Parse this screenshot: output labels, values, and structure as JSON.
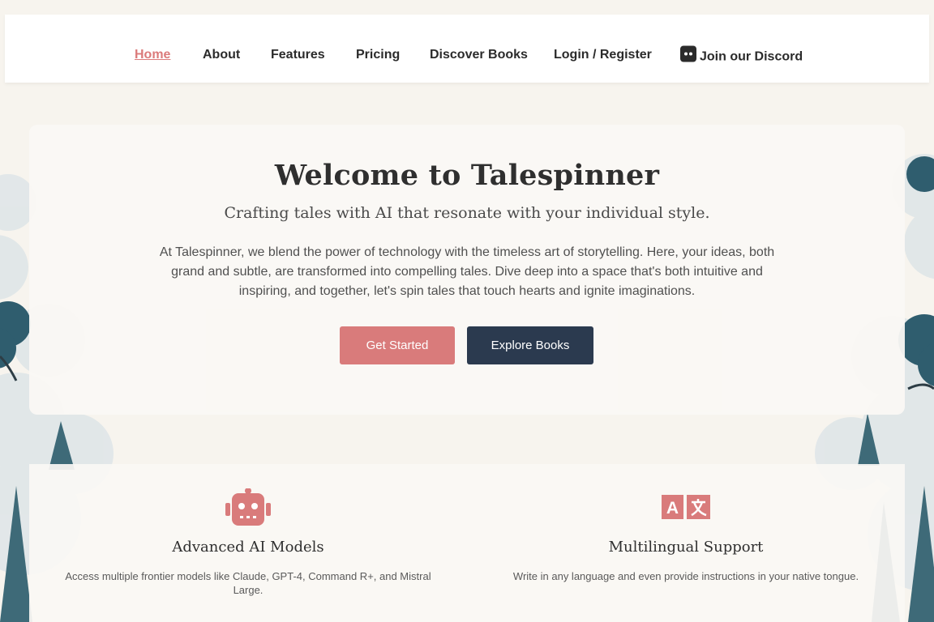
{
  "nav": {
    "items": [
      {
        "label": "Home",
        "active": true
      },
      {
        "label": "About"
      },
      {
        "label": "Features"
      },
      {
        "label": "Pricing"
      },
      {
        "label": "Discover Books"
      },
      {
        "label": "Login / Register"
      }
    ],
    "discord_label": "Join our Discord",
    "discord_icon": "discord-icon"
  },
  "hero": {
    "title": "Welcome to Talespinner",
    "subtitle": "Crafting tales with AI that resonate with your individual style.",
    "description": "At Talespinner, we blend the power of technology with the timeless art of storytelling. Here, your ideas, both grand and subtle, are transformed into compelling tales. Dive deep into a space that's both intuitive and inspiring, and together, let's spin tales that touch hearts and ignite imaginations.",
    "primary_button": "Get Started",
    "secondary_button": "Explore Books"
  },
  "features": [
    {
      "icon": "robot-icon",
      "title": "Advanced AI Models",
      "text": "Access multiple frontier models like Claude, GPT-4, Command R+, and Mistral Large."
    },
    {
      "icon": "translate-icon",
      "title": "Multilingual Support",
      "text": "Write in any language and even provide instructions in your native tongue."
    }
  ],
  "colors": {
    "accent": "#d97b7b",
    "dark": "#2b3a4f",
    "background": "#f7f4ee"
  }
}
